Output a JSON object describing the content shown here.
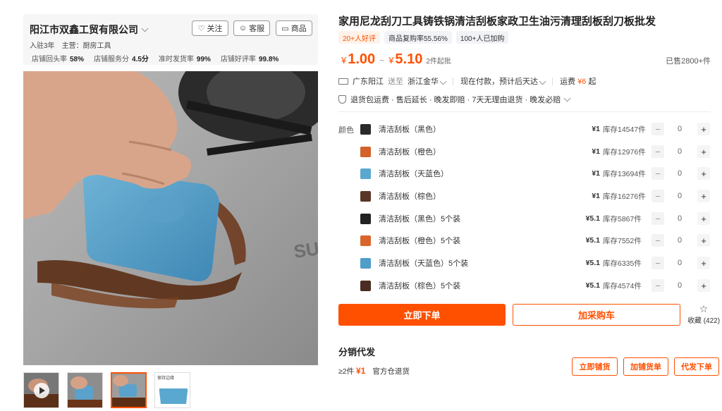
{
  "shop": {
    "name": "阳江市双鑫工贸有限公司",
    "buttons": {
      "follow": "关注",
      "service": "客服",
      "products": "商品"
    },
    "meta": {
      "years": "入驻3年",
      "main_business": "主营：厨房工具"
    },
    "stats": [
      {
        "label": "店铺回头率",
        "value": "58%"
      },
      {
        "label": "店铺服务分",
        "value": "4.5分"
      },
      {
        "label": "准时发货率",
        "value": "99%"
      },
      {
        "label": "店铺好评率",
        "value": "99.8%"
      }
    ]
  },
  "product": {
    "title": "家用尼龙刮刀工具铸铁锅清洁刮板家政卫生油污清理刮板刮刀板批发",
    "badges": [
      "20+人好评",
      "商品复购率55.56%",
      "100+人已加购"
    ],
    "price": {
      "currency": "¥",
      "min": "1.00",
      "sep": "~",
      "max": "5.10",
      "min_order": "2件起批"
    },
    "sold": "已售2800+件",
    "shipping": {
      "from": "广东阳江",
      "to_label": "送至",
      "to": "浙江金华",
      "timing": "现在付款，预计后天达",
      "fee_label": "运费",
      "fee": "¥6",
      "fee_suffix": "起"
    },
    "guarantees": "退货包运费 · 售后延长 · 晚发即赔 · 7天无理由退货 · 晚发必赔"
  },
  "variants": {
    "label": "颜色",
    "items": [
      {
        "name": "清洁刮板（黑色）",
        "price": "¥1",
        "stock": "库存14547件",
        "qty": "0",
        "color": "#2a2a2a"
      },
      {
        "name": "清洁刮板（橙色）",
        "price": "¥1",
        "stock": "库存12976件",
        "qty": "0",
        "color": "#d2612a"
      },
      {
        "name": "清洁刮板（天蓝色）",
        "price": "¥1",
        "stock": "库存13694件",
        "qty": "0",
        "color": "#5aa8cf"
      },
      {
        "name": "清洁刮板（棕色）",
        "price": "¥1",
        "stock": "库存16276件",
        "qty": "0",
        "color": "#5a3628"
      },
      {
        "name": "清洁刮板（黑色）5个装",
        "price": "¥5.1",
        "stock": "库存5867件",
        "qty": "0",
        "color": "#222222"
      },
      {
        "name": "清洁刮板（橙色）5个装",
        "price": "¥5.1",
        "stock": "库存7552件",
        "qty": "0",
        "color": "#d8652c"
      },
      {
        "name": "清洁刮板（天蓝色）5个装",
        "price": "¥5.1",
        "stock": "库存6335件",
        "qty": "0",
        "color": "#4f9dc9"
      },
      {
        "name": "清洁刮板（棕色）5个装",
        "price": "¥5.1",
        "stock": "库存4574件",
        "qty": "0",
        "color": "#4a2c22"
      }
    ]
  },
  "actions": {
    "buy_now": "立即下单",
    "add_cart": "加采购车",
    "favorite": "收藏 (422)"
  },
  "distribution": {
    "title": "分销代发",
    "min_qty": "≥2件",
    "price": "¥1",
    "return_note": "官方仓退货",
    "buttons": [
      "立即铺货",
      "加铺货单",
      "代发下单"
    ]
  },
  "thumbnails": {
    "label_4": "保持边缘"
  },
  "colors": {
    "accent": "#ff5000"
  }
}
